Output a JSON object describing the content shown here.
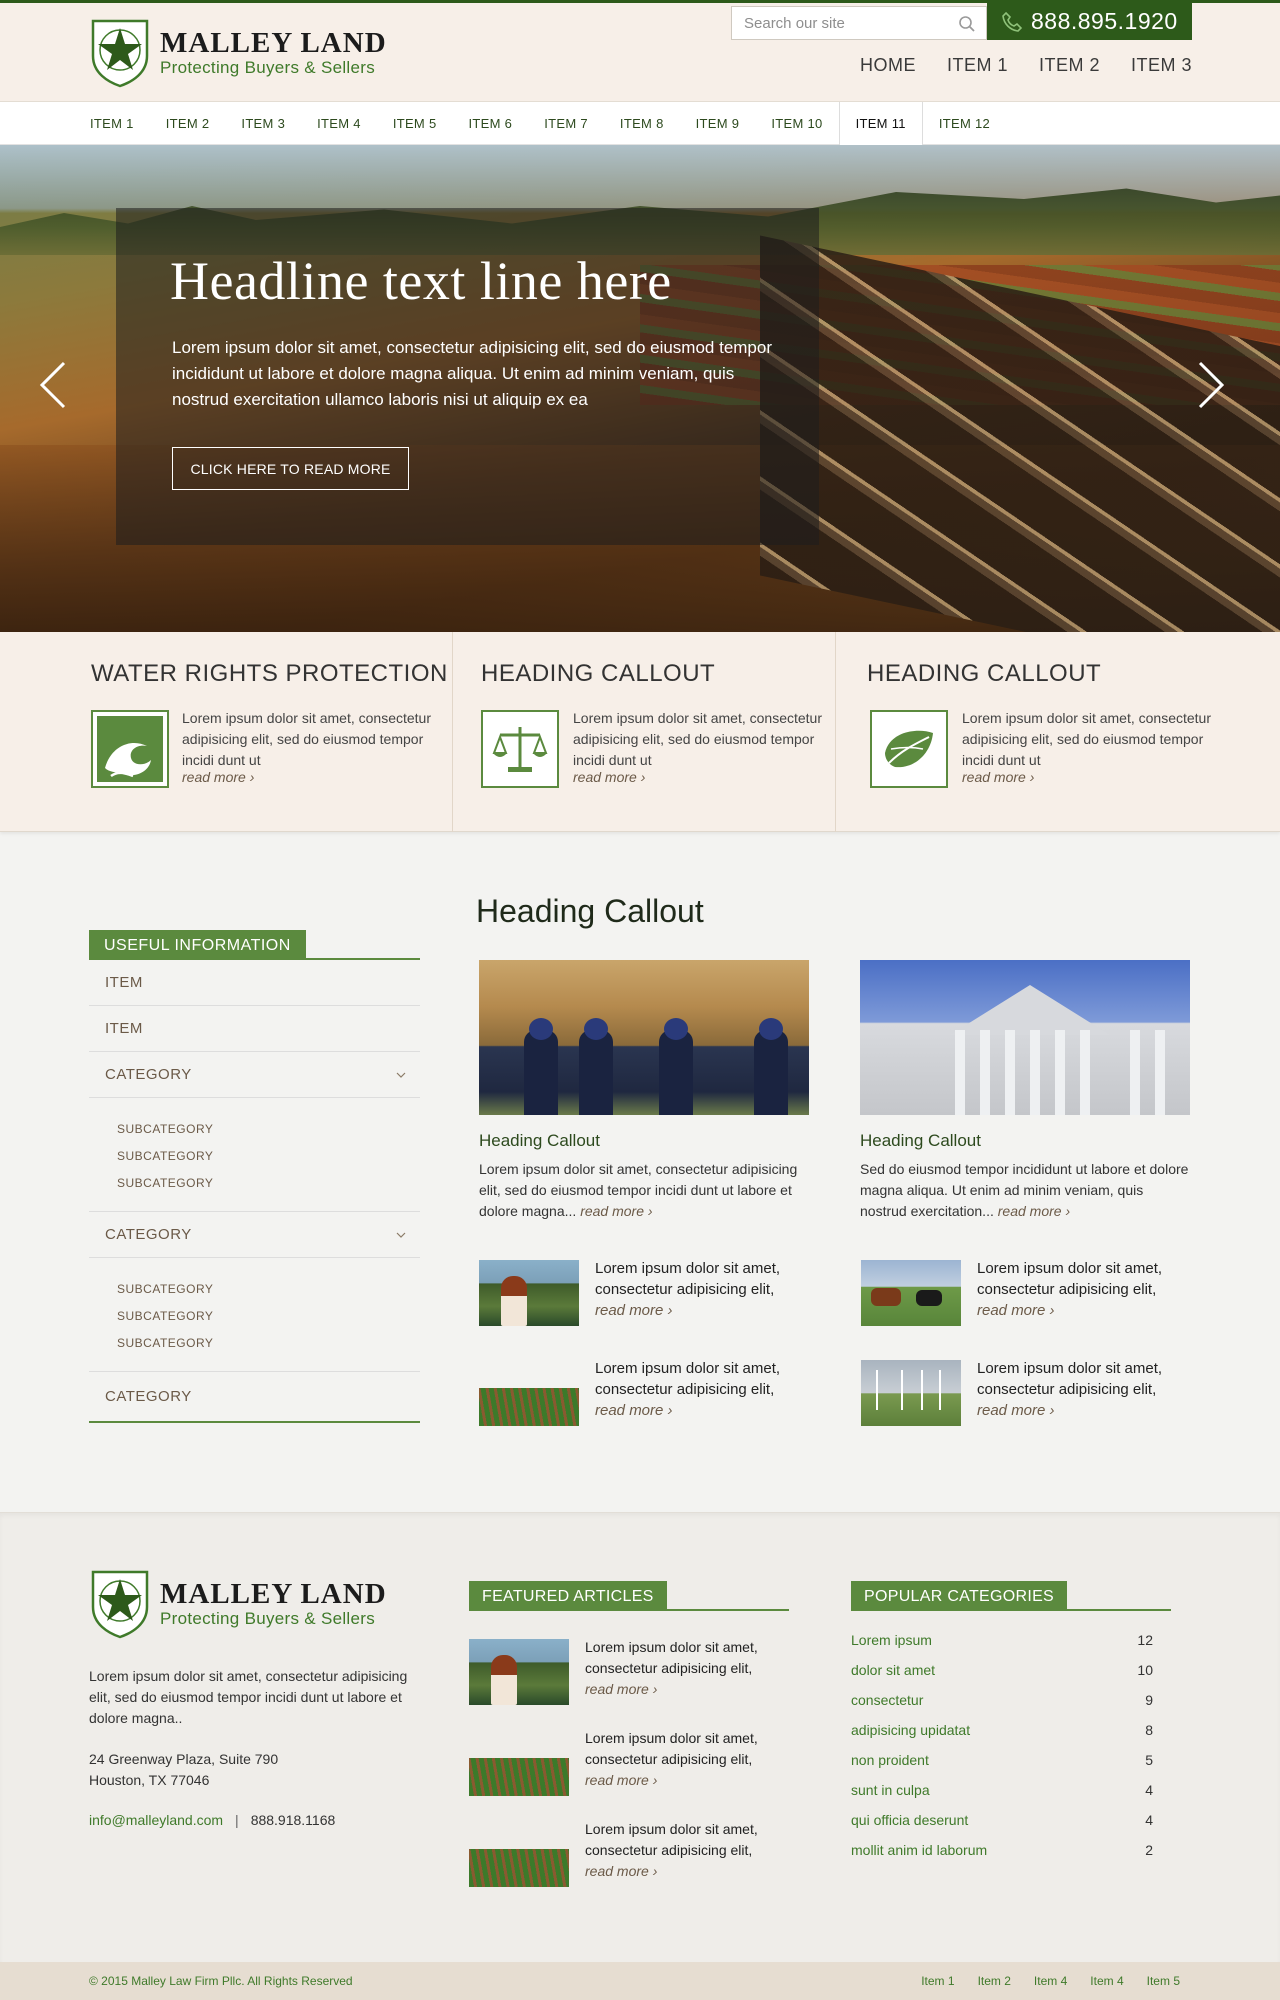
{
  "brand": {
    "name": "MALLEY LAND",
    "tagline": "Protecting Buyers & Sellers",
    "accent": "#2d5a1a",
    "green": "#5b8a3e"
  },
  "header": {
    "search_placeholder": "Search our site",
    "phone": "888.895.1920",
    "nav": [
      "HOME",
      "ITEM 1",
      "ITEM 2",
      "ITEM 3"
    ]
  },
  "subnav": {
    "items": [
      "ITEM 1",
      "ITEM 2",
      "ITEM 3",
      "ITEM 4",
      "ITEM 5",
      "ITEM 6",
      "ITEM 7",
      "ITEM 8",
      "ITEM 9",
      "ITEM 10",
      "ITEM 11",
      "ITEM 12"
    ],
    "active": "ITEM 11"
  },
  "hero": {
    "headline": "Headline text line here",
    "body": "Lorem ipsum dolor sit amet, consectetur adipisicing elit, sed do eiusmod tempor incididunt ut labore et dolore magna aliqua. Ut enim ad minim veniam, quis nostrud exercitation ullamco laboris nisi ut aliquip ex ea",
    "cta": "CLICK HERE TO READ MORE"
  },
  "callouts": [
    {
      "title": "WATER RIGHTS PROTECTION",
      "icon": "wave-icon",
      "text": "Lorem ipsum dolor sit amet, consectetur adipisicing elit, sed do eiusmod tempor incidi dunt ut",
      "more": "read more"
    },
    {
      "title": "HEADING CALLOUT",
      "icon": "scales-icon",
      "text": "Lorem ipsum dolor sit amet, consectetur adipisicing elit, sed do eiusmod tempor incidi dunt ut",
      "more": "read more"
    },
    {
      "title": "HEADING CALLOUT",
      "icon": "leaf-icon",
      "text": "Lorem ipsum dolor sit amet, consectetur adipisicing elit, sed do eiusmod tempor incidi dunt ut",
      "more": "read more"
    }
  ],
  "sidebar": {
    "title": "USEFUL INFORMATION",
    "item1": "ITEM",
    "item2": "ITEM",
    "cat1": "CATEGORY",
    "cat1_subs": [
      "SUBCATEGORY",
      "SUBCATEGORY",
      "SUBCATEGORY"
    ],
    "cat2": "CATEGORY",
    "cat2_subs": [
      "SUBCATEGORY",
      "SUBCATEGORY",
      "SUBCATEGORY"
    ],
    "cat3": "CATEGORY"
  },
  "main": {
    "heading": "Heading Callout",
    "features": [
      {
        "title": "Heading Callout",
        "text": "Lorem ipsum dolor sit amet, consectetur adipisicing elit, sed do eiusmod tempor incidi dunt ut labore et dolore magna...",
        "more": "read more"
      },
      {
        "title": "Heading Callout",
        "text": "Sed do eiusmod tempor incididunt ut labore et dolore magna aliqua. Ut enim ad minim veniam, quis nostrud exercitation...",
        "more": "read more"
      }
    ],
    "mini": [
      {
        "text": "Lorem ipsum dolor sit amet, consectetur adipisicing elit,",
        "more": "read more"
      },
      {
        "text": "Lorem ipsum dolor sit amet, consectetur adipisicing elit,",
        "more": "read more"
      },
      {
        "text": "Lorem ipsum dolor sit amet, consectetur adipisicing elit,",
        "more": "read more"
      },
      {
        "text": "Lorem ipsum dolor sit amet, consectetur adipisicing elit,",
        "more": "read more"
      }
    ]
  },
  "footer": {
    "about": "Lorem ipsum dolor sit amet, consectetur adipisicing elit, sed do eiusmod tempor incidi dunt ut labore et dolore magna..",
    "address1": "24 Greenway Plaza, Suite 790",
    "address2": "Houston, TX 77046",
    "email": "info@malleyland.com",
    "separator": "|",
    "phone": "888.918.1168",
    "featured_title": "FEATURED ARTICLES",
    "articles": [
      {
        "text": "Lorem ipsum dolor sit amet, consectetur adipisicing elit,",
        "more": "read more"
      },
      {
        "text": "Lorem ipsum dolor sit amet, consectetur adipisicing elit,",
        "more": "read more"
      },
      {
        "text": "Lorem ipsum dolor sit amet, consectetur adipisicing elit,",
        "more": "read more"
      }
    ],
    "popular_title": "POPULAR CATEGORIES",
    "categories": [
      {
        "name": "Lorem ipsum",
        "count": "12"
      },
      {
        "name": "dolor sit amet",
        "count": "10"
      },
      {
        "name": "consectetur",
        "count": "9"
      },
      {
        "name": "adipisicing upidatat",
        "count": "8"
      },
      {
        "name": "non proident",
        "count": "5"
      },
      {
        "name": "sunt in culpa",
        "count": "4"
      },
      {
        "name": "qui officia deserunt",
        "count": "4"
      },
      {
        "name": "mollit anim id laborum",
        "count": "2"
      }
    ],
    "copyright": "© 2015 Malley Law Firm Pllc. All Rights Reserved",
    "bottom_links": [
      "Item 1",
      "Item 2",
      "Item 4",
      "Item 4",
      "Item 5"
    ]
  }
}
